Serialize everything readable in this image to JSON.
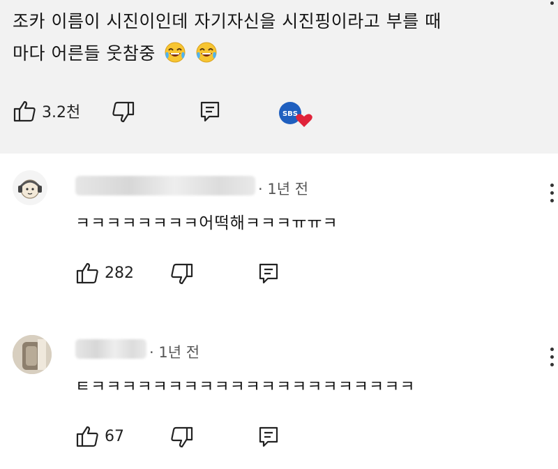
{
  "main_comment": {
    "line1": "조카 이름이 시진이인데 자기자신을 시진핑이라고 부를 때",
    "line2": "마다 어른들 웃참중",
    "emoji": "face-with-tears-of-joy",
    "likes": "3.2천",
    "creator_badge_text": "SBS",
    "colors": {
      "badge": "#1f5fbf",
      "heart": "#e0233a",
      "background": "#f2f2f2"
    }
  },
  "replies": [
    {
      "time": "· 1년 전",
      "text": "ㅋㅋㅋㅋㅋㅋㅋㅋ어떡해ㅋㅋㅋㅠㅠㅋ",
      "likes": "282"
    },
    {
      "time": "· 1년 전",
      "text": "ㅌㅋㅋㅋㅋㅋㅋㅋㅋㅋㅋㅋㅋㅋㅋㅋㅋㅋㅋㅋㅋㅋ",
      "likes": "67"
    }
  ]
}
